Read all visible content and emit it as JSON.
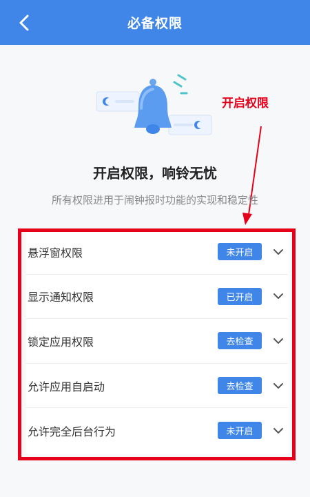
{
  "header": {
    "title": "必备权限"
  },
  "annotation": {
    "label": "开启权限"
  },
  "hero": {
    "heading": "开启权限，响铃无忧",
    "subheading": "所有权限进用于闹钟报时功能的实现和稳定性"
  },
  "permissions": [
    {
      "label": "悬浮窗权限",
      "status": "未开启"
    },
    {
      "label": "显示通知权限",
      "status": "已开启"
    },
    {
      "label": "锁定应用权限",
      "status": "去检查"
    },
    {
      "label": "允许应用自启动",
      "status": "去检查"
    },
    {
      "label": "允许完全后台行为",
      "status": "未开启"
    }
  ],
  "colors": {
    "accent": "#3f86e8",
    "annotation": "#e6001a"
  }
}
